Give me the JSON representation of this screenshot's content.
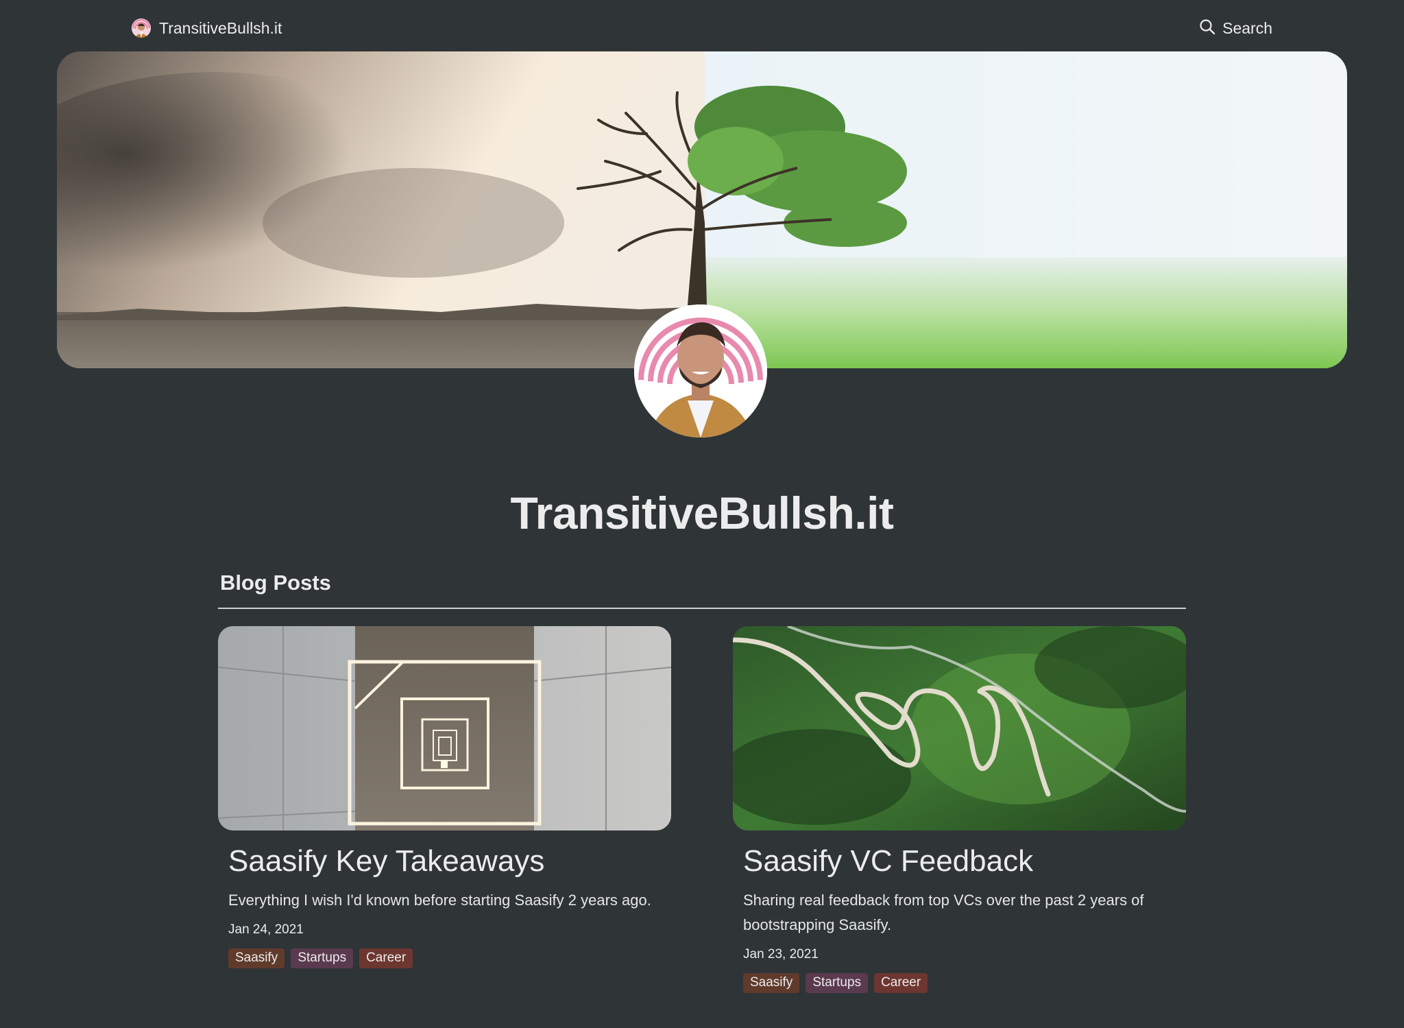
{
  "header": {
    "brand": "TransitiveBullsh.it",
    "search_label": "Search",
    "brand_icon": "avatar-icon",
    "search_icon": "search-icon"
  },
  "page": {
    "title": "TransitiveBullsh.it",
    "section_heading": "Blog Posts"
  },
  "posts": [
    {
      "title": "Saasify Key Takeaways",
      "description": "Everything I wish I'd known before starting Saasify 2 years ago.",
      "date": "Jan 24, 2021",
      "tags": [
        {
          "label": "Saasify",
          "color": "#603b2c"
        },
        {
          "label": "Startups",
          "color": "#5a3a4f"
        },
        {
          "label": "Career",
          "color": "#6e3630"
        }
      ]
    },
    {
      "title": "Saasify VC Feedback",
      "description": "Sharing real feedback from top VCs over the past 2 years of bootstrapping Saasify.",
      "date": "Jan 23, 2021",
      "tags": [
        {
          "label": "Saasify",
          "color": "#603b2c"
        },
        {
          "label": "Startups",
          "color": "#5a3a4f"
        },
        {
          "label": "Career",
          "color": "#6e3630"
        }
      ]
    }
  ],
  "colors": {
    "background": "#2f3437",
    "text": "#ececec"
  }
}
